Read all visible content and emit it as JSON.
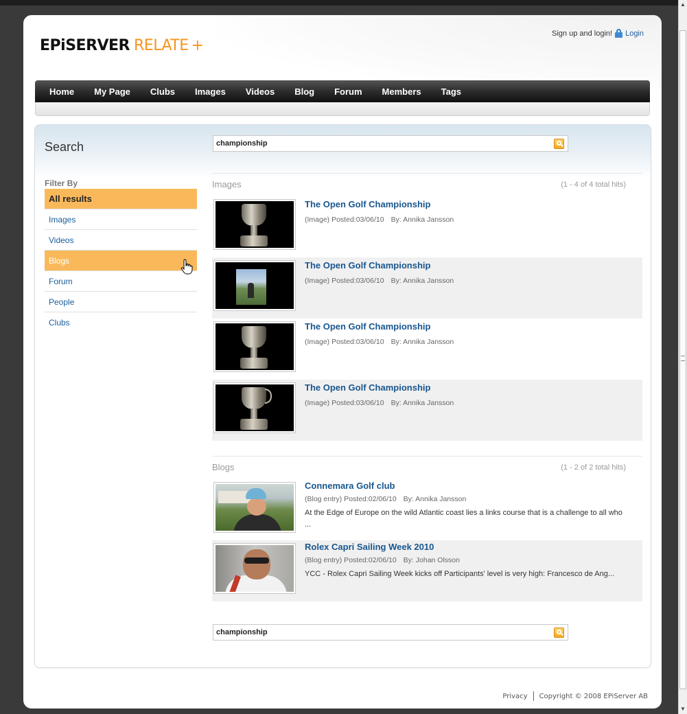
{
  "header": {
    "logo": {
      "epi": "EPiSERVER",
      "relate": "RELATE",
      "plus": "+"
    },
    "account": {
      "signup_text": "Sign up and login!",
      "login_label": "Login"
    }
  },
  "nav": {
    "items": [
      {
        "label": "Home"
      },
      {
        "label": "My Page"
      },
      {
        "label": "Clubs"
      },
      {
        "label": "Images"
      },
      {
        "label": "Videos"
      },
      {
        "label": "Blog"
      },
      {
        "label": "Forum"
      },
      {
        "label": "Members"
      },
      {
        "label": "Tags"
      }
    ]
  },
  "search": {
    "title": "Search",
    "query": "championship",
    "bottom_query": "championship"
  },
  "filter": {
    "heading": "Filter By",
    "items": [
      {
        "label": "All results",
        "state": "active"
      },
      {
        "label": "Images",
        "state": ""
      },
      {
        "label": "Videos",
        "state": ""
      },
      {
        "label": "Blogs",
        "state": "hover"
      },
      {
        "label": "Forum",
        "state": ""
      },
      {
        "label": "People",
        "state": ""
      },
      {
        "label": "Clubs",
        "state": ""
      }
    ]
  },
  "groups": {
    "images": {
      "label": "Images",
      "hits": "(1 - 4 of 4 total hits)",
      "results": [
        {
          "title": "The Open Golf Championship",
          "meta": "(Image) Posted:03/06/10",
          "by": "By: Annika Jansson",
          "thumb": "trophy-image"
        },
        {
          "title": "The Open Golf Championship",
          "meta": "(Image) Posted:03/06/10",
          "by": "By: Annika Jansson",
          "thumb": "golfer-image"
        },
        {
          "title": "The Open Golf Championship",
          "meta": "(Image) Posted:03/06/10",
          "by": "By: Annika Jansson",
          "thumb": "trophy-image"
        },
        {
          "title": "The Open Golf Championship",
          "meta": "(Image) Posted:03/06/10",
          "by": "By: Annika Jansson",
          "thumb": "trophy-image"
        }
      ]
    },
    "blogs": {
      "label": "Blogs",
      "hits": "(1 - 2 of 2 total hits)",
      "results": [
        {
          "title": "Connemara Golf club",
          "meta": "(Blog entry) Posted:02/06/10",
          "by": "By: Annika Jansson",
          "excerpt": "At the Edge of Europe on the wild Atlantic coast lies a links course that is a challenge to all who ...",
          "thumb": "man-portrait"
        },
        {
          "title": "Rolex Capri Sailing Week 2010",
          "meta": "(Blog entry) Posted:02/06/10",
          "by": "By: Johan Olsson",
          "excerpt": "YCC - Rolex Capri Sailing Week kicks off Participants' level is very high: Francesco de Ang...",
          "thumb": "sailor-portrait"
        }
      ]
    }
  },
  "footer": {
    "privacy": "Privacy",
    "copyright": "Copyright © 2008 EPiServer AB"
  },
  "colors": {
    "accent_orange": "#f9b95b",
    "link_blue": "#18568f",
    "nav_dark": "#2c2c2c"
  }
}
